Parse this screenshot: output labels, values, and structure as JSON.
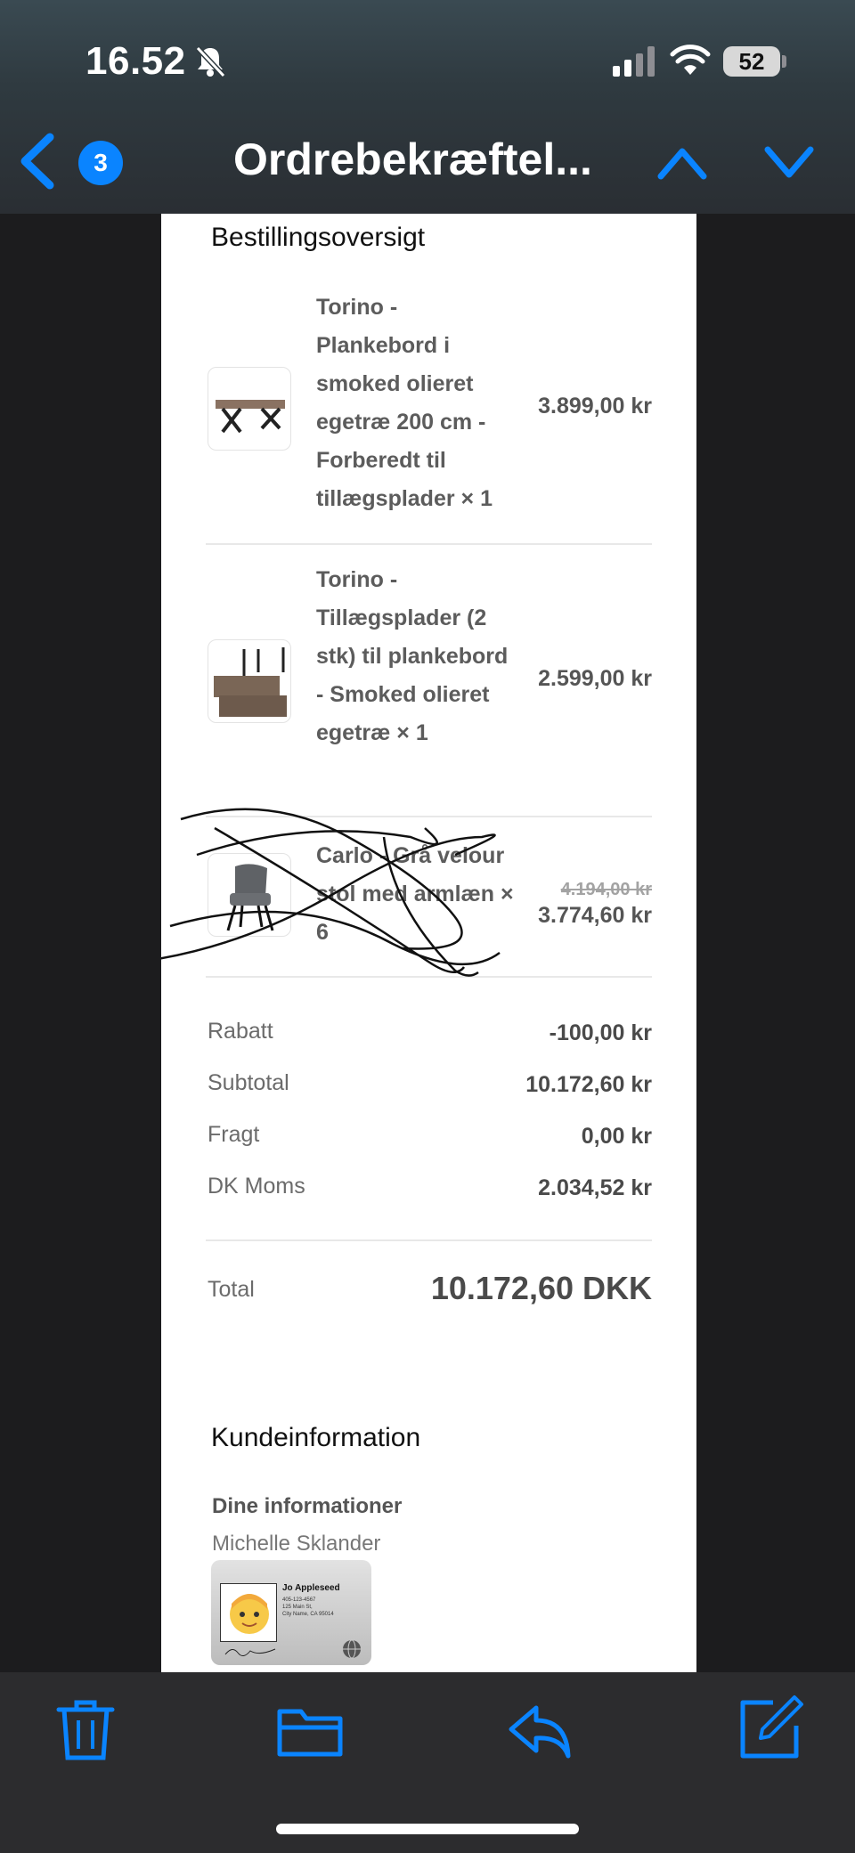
{
  "status": {
    "time": "16.52",
    "battery": "52"
  },
  "nav": {
    "badge_count": "3",
    "title": "Ordrebekræftel..."
  },
  "order": {
    "heading": "Bestillingsoversigt",
    "items": [
      {
        "name": "Torino - Plankebord i smoked olieret egetræ 200 cm - Forberedt til tillægsplader × 1",
        "price": "3.899,00 kr",
        "old_price": "",
        "thumb_icon": "table-icon"
      },
      {
        "name": "Torino - Tillægsplader (2 stk) til plankebord - Smoked olieret egetræ × 1",
        "price": "2.599,00 kr",
        "old_price": "",
        "thumb_icon": "boards-icon"
      },
      {
        "name": "Carlo - Grå velour stol med armlæn × 6",
        "price": "3.774,60 kr",
        "old_price": "4.194,00 kr",
        "thumb_icon": "chair-icon"
      }
    ],
    "summary": [
      {
        "label": "Rabatt",
        "value": "-100,00 kr"
      },
      {
        "label": "Subtotal",
        "value": "10.172,60 kr"
      },
      {
        "label": "Fragt",
        "value": "0,00 kr"
      },
      {
        "label": "DK Moms",
        "value": "2.034,52 kr"
      }
    ],
    "total_label": "Total",
    "total_value": "10.172,60 DKK"
  },
  "customer": {
    "heading": "Kundeinformation",
    "info_label": "Dine informationer",
    "name": "Michelle Sklander",
    "card": {
      "name": "Jo Appleseed",
      "phone": "405-123-4567",
      "street": "125 Main St,",
      "city": "City Name, CA 95014"
    }
  },
  "colors": {
    "accent": "#0a84ff",
    "sheet_bg": "#ffffff",
    "app_bg": "#1c1c1e"
  }
}
